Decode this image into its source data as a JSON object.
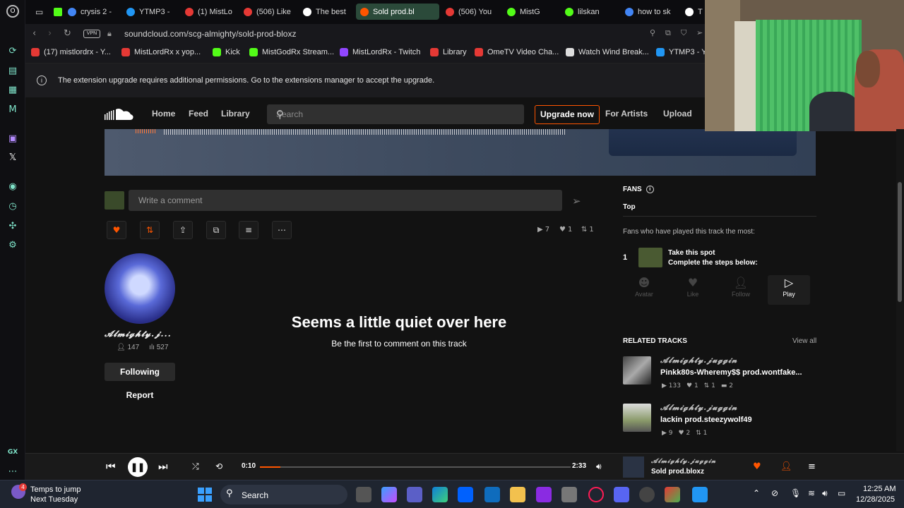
{
  "browser": {
    "tabs": [
      {
        "label": "crysis 2 -",
        "color": "#4285f4"
      },
      {
        "label": "YTMP3 -",
        "color": "#2196f3"
      },
      {
        "label": "(1) MistLo",
        "color": "#e53935"
      },
      {
        "label": "(506) Like",
        "color": "#e53935"
      },
      {
        "label": "The best",
        "color": "#ffffff"
      },
      {
        "label": "Sold prod.bl",
        "color": "#ff5500"
      },
      {
        "label": "(506) You",
        "color": "#e53935"
      },
      {
        "label": "MistG",
        "color": "#53fc18"
      },
      {
        "label": "lilskan",
        "color": "#53fc18"
      },
      {
        "label": "how to sk",
        "color": "#4285f4"
      },
      {
        "label": "T",
        "color": "#ffffff"
      }
    ],
    "vpn_label": "VPN",
    "url": "soundcloud.com/scg-almighty/sold-prod-bloxz",
    "bookmarks": [
      {
        "label": "(17) mistlordrx - Y...",
        "color": "#e53935"
      },
      {
        "label": "MistLordRx x yop...",
        "color": "#e53935"
      },
      {
        "label": "Kick",
        "color": "#53fc18"
      },
      {
        "label": "MistGodRx Stream...",
        "color": "#53fc18"
      },
      {
        "label": "MistLordRx - Twitch",
        "color": "#9146ff"
      },
      {
        "label": "Library",
        "color": "#e53935"
      },
      {
        "label": "OmeTV Video Cha...",
        "color": "#e53935"
      },
      {
        "label": "Watch Wind Break...",
        "color": "#dddddd"
      },
      {
        "label": "YTMP3 - Y",
        "color": "#2196f3"
      }
    ],
    "notice": "The extension upgrade requires additional permissions. Go to the extensions manager to accept the upgrade."
  },
  "header": {
    "nav": [
      "Home",
      "Feed",
      "Library"
    ],
    "search_placeholder": "Search",
    "upgrade": "Upgrade now",
    "for_artists": "For Artists",
    "upload": "Upload"
  },
  "comment": {
    "placeholder": "Write a comment"
  },
  "stats": {
    "plays": "7",
    "likes": "1",
    "reposts": "1"
  },
  "uploader": {
    "name": "𝓐𝓵𝓶𝓲𝓰𝓱𝓽𝔂.𝓳...",
    "followers": "147",
    "tracks": "527",
    "following_label": "Following",
    "report_label": "Report"
  },
  "empty": {
    "title": "Seems a little quiet over here",
    "subtitle": "Be the first to comment on this track"
  },
  "fans": {
    "title": "FANS",
    "tab": "Top",
    "description": "Fans who have played this track the most:",
    "rank": "1",
    "take_spot": "Take this spot",
    "steps_label": "Complete the steps below:",
    "steps": [
      "Avatar",
      "Like",
      "Follow",
      "Play"
    ]
  },
  "related": {
    "title": "RELATED TRACKS",
    "view_all": "View all",
    "tracks": [
      {
        "artist": "𝓐𝓵𝓶𝓲𝓰𝓱𝓽𝔂.𝓳𝓾𝓰𝓰𝓲𝓷",
        "title": "Pinkk80s-Wheremy$$ prod.wontfake...",
        "plays": "133",
        "likes": "1",
        "reposts": "1",
        "comments": "2"
      },
      {
        "artist": "𝓐𝓵𝓶𝓲𝓰𝓱𝓽𝔂.𝓳𝓾𝓰𝓰𝓲𝓷",
        "title": "lackin prod.steezywolf49",
        "plays": "9",
        "likes": "2",
        "reposts": "1"
      }
    ]
  },
  "player": {
    "current_time": "0:10",
    "duration": "2:33",
    "progress": 0.065,
    "artist": "𝓐𝓵𝓶𝓲𝓰𝓱𝓽𝔂.𝓳𝓾𝓰𝓰𝓲𝓷",
    "title": "Sold prod.bloxz"
  },
  "taskbar": {
    "weather_line1": "Temps to jump",
    "weather_line2": "Next Tuesday",
    "weather_badge": "4",
    "search": "Search",
    "time": "12:25 AM",
    "date": "12/28/2025"
  },
  "colors": {
    "accent": "#ff5500",
    "background": "#121212"
  }
}
